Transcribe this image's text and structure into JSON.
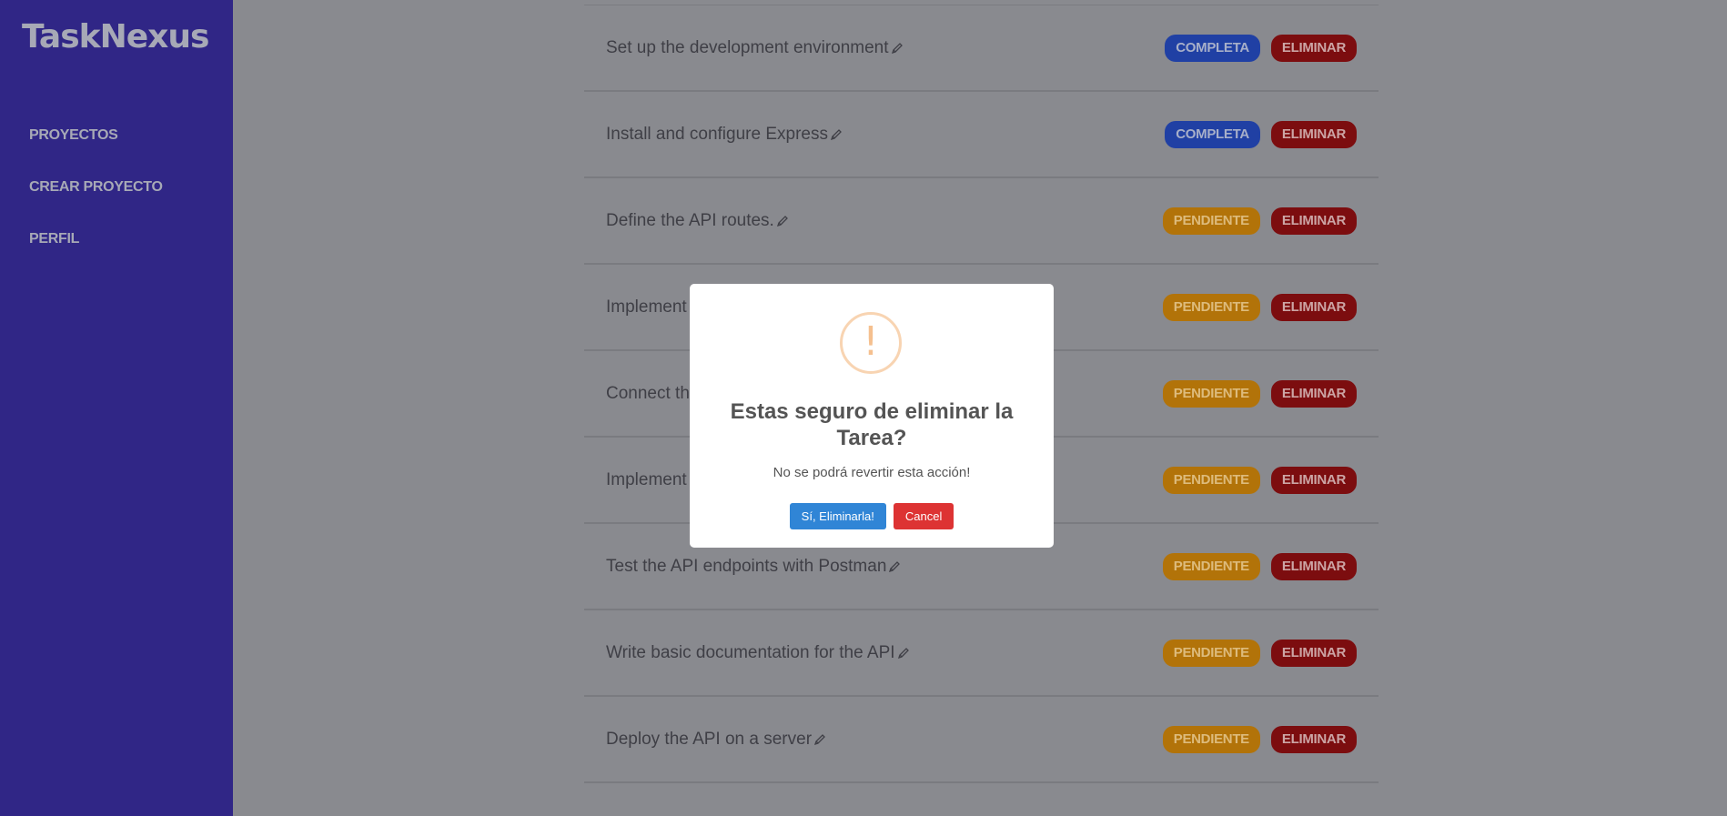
{
  "app": {
    "name": "TaskNexus"
  },
  "sidebar": {
    "items": [
      {
        "label": "PROYECTOS"
      },
      {
        "label": "CREAR PROYECTO"
      },
      {
        "label": "PERFIL"
      }
    ]
  },
  "tasks": [
    {
      "name": "Set up the development environment",
      "status": "COMPLETA",
      "delete_label": "ELIMINAR"
    },
    {
      "name": "Install and configure Express",
      "status": "COMPLETA",
      "delete_label": "ELIMINAR"
    },
    {
      "name": "Define the API routes.",
      "status": "PENDIENTE",
      "delete_label": "ELIMINAR"
    },
    {
      "name": "Implement",
      "status": "PENDIENTE",
      "delete_label": "ELIMINAR"
    },
    {
      "name": "Connect the",
      "status": "PENDIENTE",
      "delete_label": "ELIMINAR"
    },
    {
      "name": "Implement",
      "status": "PENDIENTE",
      "delete_label": "ELIMINAR"
    },
    {
      "name": "Test the API endpoints with Postman",
      "status": "PENDIENTE",
      "delete_label": "ELIMINAR"
    },
    {
      "name": "Write basic documentation for the API",
      "status": "PENDIENTE",
      "delete_label": "ELIMINAR"
    },
    {
      "name": "Deploy the API on a server",
      "status": "PENDIENTE",
      "delete_label": "ELIMINAR"
    }
  ],
  "modal": {
    "icon": "!",
    "title": "Estas seguro de eliminar la Tarea?",
    "text": "No se podrá revertir esta acción!",
    "confirm_label": "Sí, Eliminarla!",
    "cancel_label": "Cancel"
  },
  "colors": {
    "sidebar": "#302686",
    "completa": "#2040a4",
    "pendiente": "#b27309",
    "eliminar": "#7c0d0f",
    "confirm": "#3085d6",
    "cancel": "#dd3333"
  }
}
